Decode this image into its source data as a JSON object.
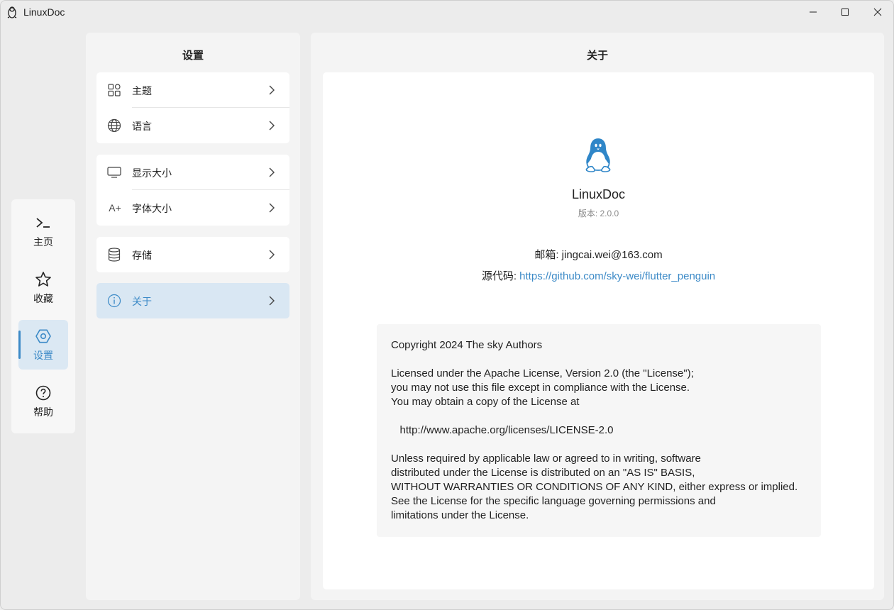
{
  "window": {
    "title": "LinuxDoc",
    "controls": {
      "minimize": "minimize-icon",
      "maximize": "maximize-icon",
      "close": "close-icon"
    }
  },
  "nav": {
    "items": [
      {
        "label": "主页",
        "icon": "terminal-icon"
      },
      {
        "label": "收藏",
        "icon": "star-icon"
      },
      {
        "label": "设置",
        "icon": "settings-icon",
        "active": true
      },
      {
        "label": "帮助",
        "icon": "help-icon"
      }
    ]
  },
  "settings": {
    "title": "设置",
    "groups": [
      {
        "items": [
          {
            "label": "主题",
            "icon": "theme-grid-icon"
          },
          {
            "label": "语言",
            "icon": "globe-icon"
          }
        ]
      },
      {
        "items": [
          {
            "label": "显示大小",
            "icon": "monitor-icon"
          },
          {
            "label": "字体大小",
            "icon": "font-size-icon",
            "icon_text": "A+"
          }
        ]
      },
      {
        "items": [
          {
            "label": "存储",
            "icon": "database-icon"
          }
        ]
      },
      {
        "items": [
          {
            "label": "关于",
            "icon": "info-icon",
            "active": true
          }
        ]
      }
    ]
  },
  "about": {
    "title": "关于",
    "app_name": "LinuxDoc",
    "version": "版本: 2.0.0",
    "email": "邮箱: jingcai.wei@163.com",
    "source_label": "源代码: ",
    "source_url": "https://github.com/sky-wei/flutter_penguin",
    "license_lines": [
      "Copyright 2024 The sky Authors",
      "",
      "Licensed under the Apache License, Version 2.0 (the \"License\");",
      "you may not use this file except in compliance with the License.",
      "You may obtain a copy of the License at",
      "",
      "   http://www.apache.org/licenses/LICENSE-2.0",
      "",
      "Unless required by applicable law or agreed to in writing, software",
      "distributed under the License is distributed on an \"AS IS\" BASIS,",
      "WITHOUT WARRANTIES OR CONDITIONS OF ANY KIND, either express or implied.",
      "See the License for the specific language governing permissions and",
      "limitations under the License."
    ]
  },
  "colors": {
    "accent": "#3c8ac7",
    "active_bg": "#d9e7f3",
    "panel_bg": "#f4f4f4"
  }
}
